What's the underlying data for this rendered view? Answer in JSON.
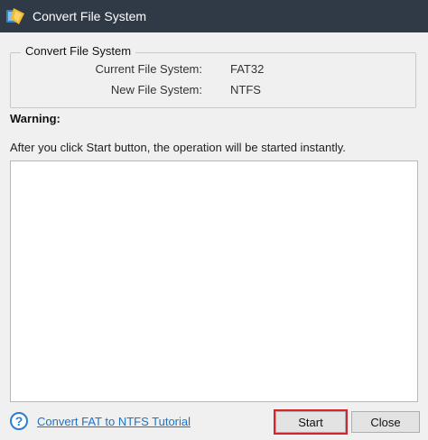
{
  "window": {
    "title": "Convert File System",
    "icon": "minitool-partition-wizard-icon"
  },
  "group": {
    "legend": "Convert File System",
    "current_label": "Current File System:",
    "current_value": "FAT32",
    "new_label": "New File System:",
    "new_value": "NTFS"
  },
  "warning": {
    "title": "Warning:",
    "message": "After you click Start button, the operation will be started instantly."
  },
  "footer": {
    "help_icon": "help-icon",
    "help_glyph": "?",
    "tutorial_link": "Convert FAT to NTFS Tutorial",
    "start_label": "Start",
    "close_label": "Close"
  },
  "colors": {
    "titlebar": "#2f3a46",
    "link": "#1a73c9",
    "highlight": "#d9232b"
  }
}
